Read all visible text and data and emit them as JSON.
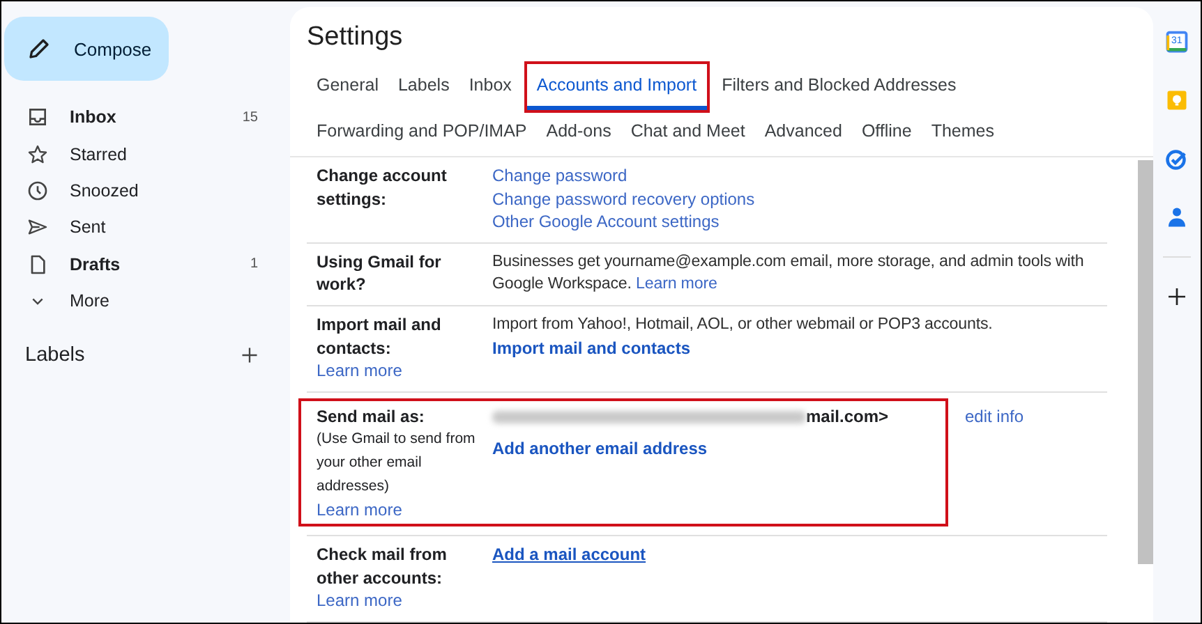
{
  "compose": {
    "label": "Compose"
  },
  "sidebar": {
    "items": [
      {
        "label": "Inbox",
        "count": "15",
        "bold": true
      },
      {
        "label": "Starred",
        "bold": false
      },
      {
        "label": "Snoozed",
        "bold": false
      },
      {
        "label": "Sent",
        "bold": false
      },
      {
        "label": "Drafts",
        "count": "1",
        "bold": true
      },
      {
        "label": "More",
        "bold": false
      }
    ],
    "labels_heading": "Labels"
  },
  "settings": {
    "title": "Settings",
    "tab_rows": [
      [
        {
          "label": "General",
          "selected": false
        },
        {
          "label": "Labels",
          "selected": false
        },
        {
          "label": "Inbox",
          "selected": false
        },
        {
          "label": "Accounts and Import",
          "selected": true,
          "highlighted": true
        },
        {
          "label": "Filters and Blocked Addresses",
          "selected": false
        }
      ],
      [
        {
          "label": "Forwarding and POP/IMAP",
          "selected": false
        },
        {
          "label": "Add-ons",
          "selected": false
        },
        {
          "label": "Chat and Meet",
          "selected": false
        },
        {
          "label": "Advanced",
          "selected": false
        },
        {
          "label": "Offline",
          "selected": false
        },
        {
          "label": "Themes",
          "selected": false
        }
      ]
    ],
    "sections": [
      {
        "label": "Change account settings:",
        "highlighted": false,
        "content": [
          {
            "kind": "link",
            "text": "Change password"
          },
          {
            "kind": "link",
            "text": "Change password recovery options"
          },
          {
            "kind": "link",
            "text": "Other Google Account settings"
          }
        ]
      },
      {
        "label": "Using Gmail for work?",
        "highlighted": false,
        "content": [
          {
            "kind": "text",
            "text": "Businesses get yourname@example.com email, more storage, and admin tools with Google Workspace.",
            "link": "Learn more"
          }
        ]
      },
      {
        "label": "Import mail and contacts:",
        "label_link": "Learn more",
        "highlighted": false,
        "content": [
          {
            "kind": "text",
            "text": "Import from Yahoo!, Hotmail, AOL, or other webmail or POP3 accounts."
          },
          {
            "kind": "action",
            "text": "Import mail and contacts"
          }
        ]
      },
      {
        "label": "Send mail as:",
        "note": "(Use Gmail to send from your other email addresses)",
        "label_link": "Learn more",
        "highlighted": true,
        "content": [
          {
            "kind": "address",
            "text": "mail.com>"
          },
          {
            "kind": "action",
            "text": "Add another email address"
          }
        ],
        "side_link": "edit info"
      },
      {
        "label": "Check mail from other accounts:",
        "label_link": "Learn more",
        "highlighted": false,
        "content": [
          {
            "kind": "underlined",
            "text": "Add a mail account"
          }
        ]
      }
    ]
  },
  "right_rail": {
    "calendar_day": "31"
  }
}
